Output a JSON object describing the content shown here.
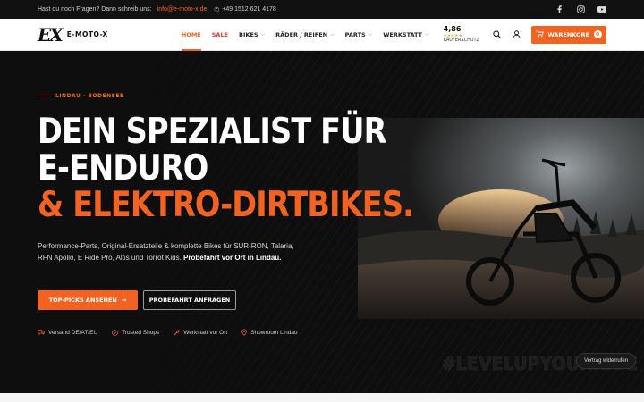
{
  "topbar": {
    "message": "Hast du noch Fragen? Dann schreib uns:",
    "email": "info@e-moto-x.de",
    "phone": "+49 1512 621 4178",
    "social": [
      "facebook-icon",
      "instagram-icon",
      "youtube-icon"
    ]
  },
  "header": {
    "logo_mark": "EX",
    "logo_text": "E-MOTO-X",
    "nav": {
      "home": "HOME",
      "sale": "SALE",
      "bikes": "BIKES",
      "raeder": "RÄDER / REIFEN",
      "parts": "PARTS",
      "werkstatt": "WERKSTATT"
    },
    "rating": {
      "score": "4,86",
      "stars": "★★★★★",
      "label": "KÄUFERSCHUTZ"
    },
    "cart": {
      "label": "WARENKORB",
      "count": "0"
    }
  },
  "hero": {
    "tag": "LINDAU · BODENSEE",
    "headline_line1": "DEIN SPEZIALIST FÜR",
    "headline_line2": "E-ENDURO",
    "headline_line3": "& ELEKTRO-DIRTBIKES.",
    "description": "Performance-Parts, Original-Ersatzteile & komplette Bikes für SUR-RON, Talaria, RFN Apollo, E Ride Pro, Altis und Torrot Kids.",
    "description_bold": "Probefahrt vor Ort in Lindau.",
    "primary_button": "TOP-PICKS ANSEHEN",
    "primary_arrow": "→",
    "secondary_button": "PROBEFAHRT ANFRAGEN",
    "features": [
      {
        "label": "Versand DE/AT/EU",
        "icon": "truck-icon"
      },
      {
        "label": "Trusted Shops",
        "icon": "shield-check-icon"
      },
      {
        "label": "Werkstatt vor Ort",
        "icon": "wrench-icon"
      },
      {
        "label": "Showroom Lindau",
        "icon": "location-pin-icon"
      }
    ],
    "watermark": "#LEVELUPYOURRIDE"
  },
  "consent_button": "Vertrag widerrufen",
  "colors": {
    "accent": "#f26322",
    "sale": "#e63323",
    "dark": "#0d0d0d"
  }
}
